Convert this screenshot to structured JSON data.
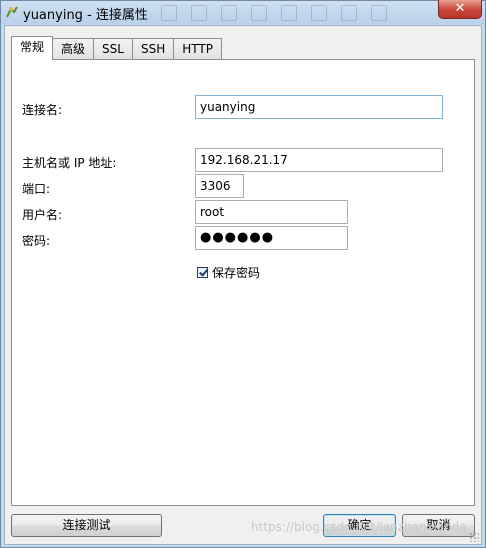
{
  "window": {
    "title": "yuanying - 连接属性",
    "close_label": "✕"
  },
  "tabs": [
    {
      "label": "常规",
      "active": true
    },
    {
      "label": "高级",
      "active": false
    },
    {
      "label": "SSL",
      "active": false
    },
    {
      "label": "SSH",
      "active": false
    },
    {
      "label": "HTTP",
      "active": false
    }
  ],
  "form": {
    "connection_name_label": "连接名:",
    "connection_name_value": "yuanying",
    "host_label": "主机名或 IP 地址:",
    "host_value": "192.168.21.17",
    "port_label": "端口:",
    "port_value": "3306",
    "username_label": "用户名:",
    "username_value": "root",
    "password_label": "密码:",
    "password_value": "●●●●●●",
    "save_password_label": "保存密码",
    "save_password_checked": true
  },
  "buttons": {
    "test_connection": "连接测试",
    "ok": "确定",
    "cancel": "取消"
  },
  "watermark": "https://blog.csdn.net/lanzhanxiaoda",
  "colors": {
    "title_bar": "#b9d1ea",
    "close_button": "#c7473a",
    "focus_border": "#7fb4d8"
  }
}
